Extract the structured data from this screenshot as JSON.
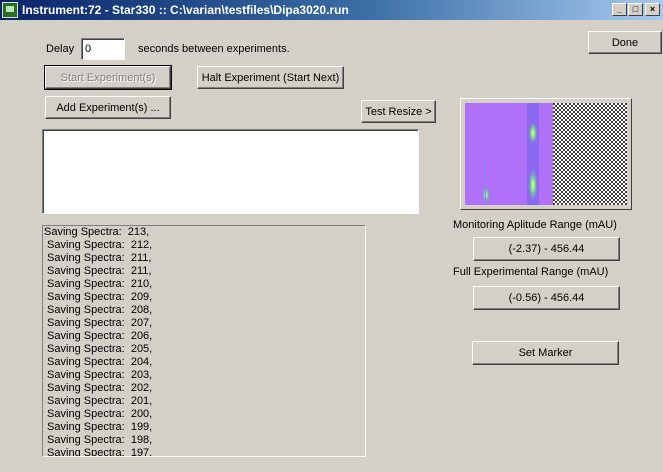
{
  "window": {
    "title": "Instrument:72 - Star330 :: C:\\varian\\testfiles\\Dipa3020.run",
    "minimize_glyph": "_",
    "maximize_glyph": "□",
    "close_glyph": "×"
  },
  "delay": {
    "label": "Delay",
    "value": "0",
    "suffix": "seconds between experiments."
  },
  "buttons": {
    "done": "Done",
    "start_experiment": "Start Experiment(s)",
    "halt_experiment": "Halt Experiment (Start Next)",
    "add_experiment": "Add Experiment(s) ...",
    "test_resize": "Test Resize >",
    "set_marker": "Set Marker"
  },
  "monitoring": {
    "label": "Monitoring Aplitude Range (mAU)",
    "value": "(-2.37) - 456.44"
  },
  "full_range": {
    "label": "Full Experimental Range (mAU)",
    "value": "(-0.56) - 456.44"
  },
  "log_lines": [
    "Saving Spectra:  213,",
    " Saving Spectra:  212,",
    " Saving Spectra:  211,",
    " Saving Spectra:  211,",
    " Saving Spectra:  210,",
    " Saving Spectra:  209,",
    " Saving Spectra:  208,",
    " Saving Spectra:  207,",
    " Saving Spectra:  206,",
    " Saving Spectra:  205,",
    " Saving Spectra:  204,",
    " Saving Spectra:  203,",
    " Saving Spectra:  202,",
    " Saving Spectra:  201,",
    " Saving Spectra:  200,",
    " Saving Spectra:  199,",
    " Saving Spectra:  198,",
    " Saving Spectra:  197,"
  ],
  "colors": {
    "window_bg": "#d4d0c8",
    "titlebar_start": "#0a246a",
    "titlebar_end": "#a6caf0",
    "spectrum_bg": "#b26cf0",
    "spectrum_peak": "#c8f060"
  }
}
